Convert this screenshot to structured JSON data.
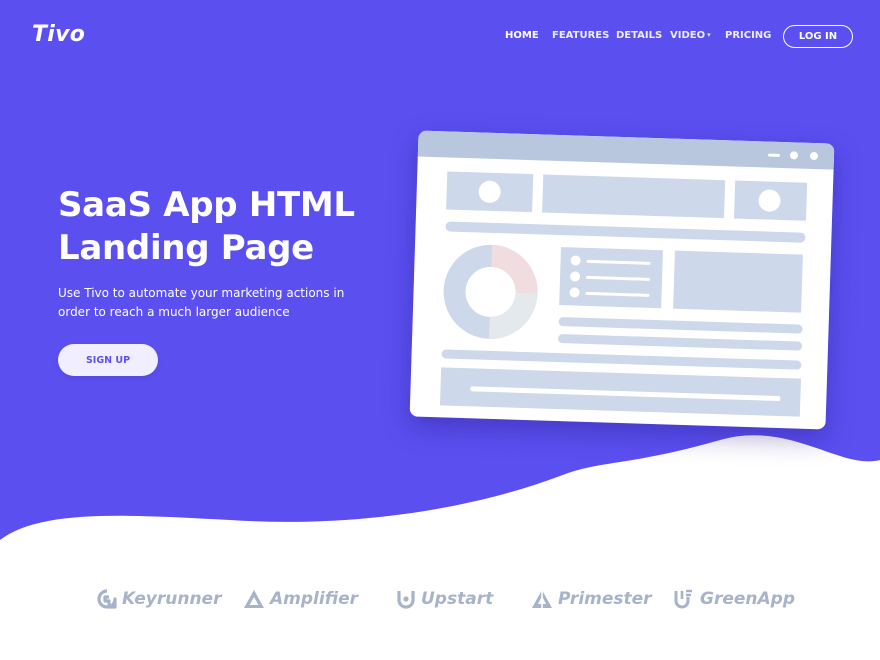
{
  "brand": {
    "name": "Tivo"
  },
  "nav": {
    "items": [
      {
        "label": "HOME",
        "active": true
      },
      {
        "label": "FEATURES"
      },
      {
        "label": "DETAILS"
      },
      {
        "label": "VIDEO",
        "dropdown": true
      },
      {
        "label": "PRICING"
      }
    ],
    "login_label": "LOG IN"
  },
  "hero": {
    "title": "SaaS App HTML Landing Page",
    "subtitle": "Use Tivo to automate your marketing actions in order to reach a much larger audience",
    "cta_label": "SIGN UP",
    "colors": {
      "background": "#5b4ff0",
      "cta_text": "#5b4ff0",
      "mockup_fill": "#cdd8ea"
    }
  },
  "clients": [
    {
      "name": "Keyrunner",
      "icon": "keyrunner-logo-icon"
    },
    {
      "name": "Amplifier",
      "icon": "amplifier-logo-icon"
    },
    {
      "name": "Upstart",
      "icon": "upstart-logo-icon"
    },
    {
      "name": "Primester",
      "icon": "primester-logo-icon"
    },
    {
      "name": "GreenApp",
      "icon": "greenapp-logo-icon"
    }
  ]
}
